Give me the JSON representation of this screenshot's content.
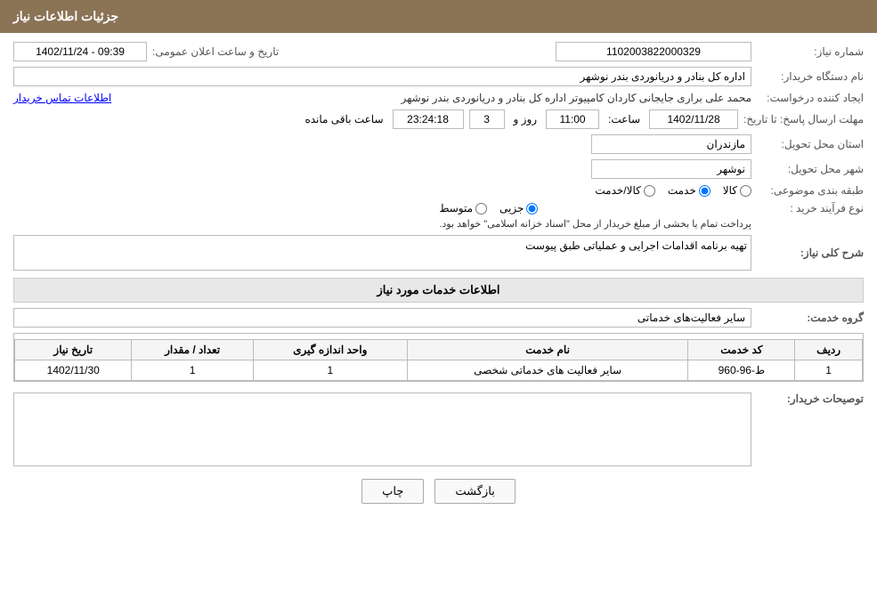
{
  "header": {
    "title": "جزئیات اطلاعات نیاز"
  },
  "form": {
    "need_number_label": "شماره نیاز:",
    "need_number_value": "1102003822000329",
    "buyer_org_label": "نام دستگاه خریدار:",
    "buyer_org_value": "اداره کل بنادر و دریانوردی بندر نوشهر",
    "announcement_label": "تاریخ و ساعت اعلان عمومی:",
    "announcement_value": "1402/11/24 - 09:39",
    "creator_label": "ایجاد کننده درخواست:",
    "creator_value": "محمد علی براری جایجانی کاردان کامپیوتر اداره کل بنادر و دریانوردی بندر نوشهر",
    "contact_link": "اطلاعات تماس خریدار",
    "deadline_label": "مهلت ارسال پاسخ: تا تاریخ:",
    "deadline_date": "1402/11/28",
    "deadline_time_label": "ساعت:",
    "deadline_time": "11:00",
    "deadline_days_label": "روز و",
    "deadline_days": "3",
    "deadline_remaining_label": "ساعت باقی مانده",
    "deadline_remaining": "23:24:18",
    "province_label": "استان محل تحویل:",
    "province_value": "مازندران",
    "city_label": "شهر محل تحویل:",
    "city_value": "نوشهر",
    "category_label": "طبقه بندی موضوعی:",
    "category_options": [
      {
        "label": "کالا",
        "value": "kala"
      },
      {
        "label": "خدمت",
        "value": "khedmat"
      },
      {
        "label": "کالا/خدمت",
        "value": "kala_khedmat"
      }
    ],
    "category_selected": "khedmat",
    "purchase_type_label": "نوع فرآیند خرید :",
    "purchase_type_options": [
      {
        "label": "جزیی",
        "value": "jozi"
      },
      {
        "label": "متوسط",
        "value": "motavaset"
      }
    ],
    "purchase_type_selected": "jozi",
    "purchase_note": "پرداخت تمام یا بخشی از مبلغ خریدار از محل \"اسناد خزانه اسلامی\" خواهد بود.",
    "need_desc_label": "شرح کلی نیاز:",
    "need_desc_value": "تهیه برنامه اقدامات اجرایی و عملیاتی طبق پیوست",
    "services_info_title": "اطلاعات خدمات مورد نیاز",
    "service_group_label": "گروه خدمت:",
    "service_group_value": "سایر فعالیت‌های خدماتی",
    "table": {
      "columns": [
        "ردیف",
        "کد خدمت",
        "نام خدمت",
        "واحد اندازه گیری",
        "تعداد / مقدار",
        "تاریخ نیاز"
      ],
      "rows": [
        {
          "row": "1",
          "code": "ط-96-960",
          "name": "سایر فعالیت های خدماتی شخصی",
          "unit": "1",
          "quantity": "1",
          "date": "1402/11/30"
        }
      ]
    },
    "buyer_desc_label": "توصیحات خریدار:",
    "buyer_desc_value": ""
  },
  "buttons": {
    "print_label": "چاپ",
    "back_label": "بازگشت"
  }
}
